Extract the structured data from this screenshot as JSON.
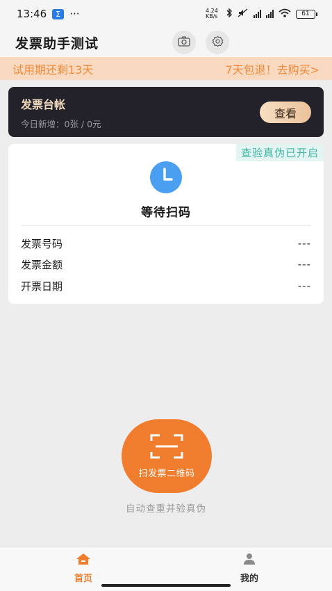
{
  "status_bar": {
    "time": "13:46",
    "app_icon": "Σ",
    "dots": "···",
    "speed": "4.24 KB/s",
    "battery": "61"
  },
  "header": {
    "title": "发票助手测试",
    "icons": [
      "camera-icon",
      "gear-icon"
    ]
  },
  "trial_banner": {
    "left_text": "试用期还剩13天",
    "right_text": "7天包退！去购买>"
  },
  "ledger": {
    "title": "发票台帐",
    "subtitle": "今日新增：0张 / 0元",
    "button_label": "查看"
  },
  "invoice_card": {
    "verify_tag": "查验真伪已开启",
    "status_text": "等待扫码",
    "rows": [
      {
        "label": "发票号码",
        "value": "---"
      },
      {
        "label": "发票金额",
        "value": "---"
      },
      {
        "label": "开票日期",
        "value": "---"
      }
    ]
  },
  "scan": {
    "button_label": "扫发票二维码",
    "hint": "自动查重并验真伪"
  },
  "bottom_nav": {
    "items": [
      {
        "label": "首页",
        "icon": "home-icon",
        "active": true
      },
      {
        "label": "我的",
        "icon": "person-icon",
        "active": false
      }
    ]
  },
  "colors": {
    "accent": "#f07d2d",
    "banner_bg": "#f9d9bf",
    "ledger_bg": "#23222a",
    "verify_green": "#43b5a3",
    "clock_blue": "#4a9ff0"
  }
}
